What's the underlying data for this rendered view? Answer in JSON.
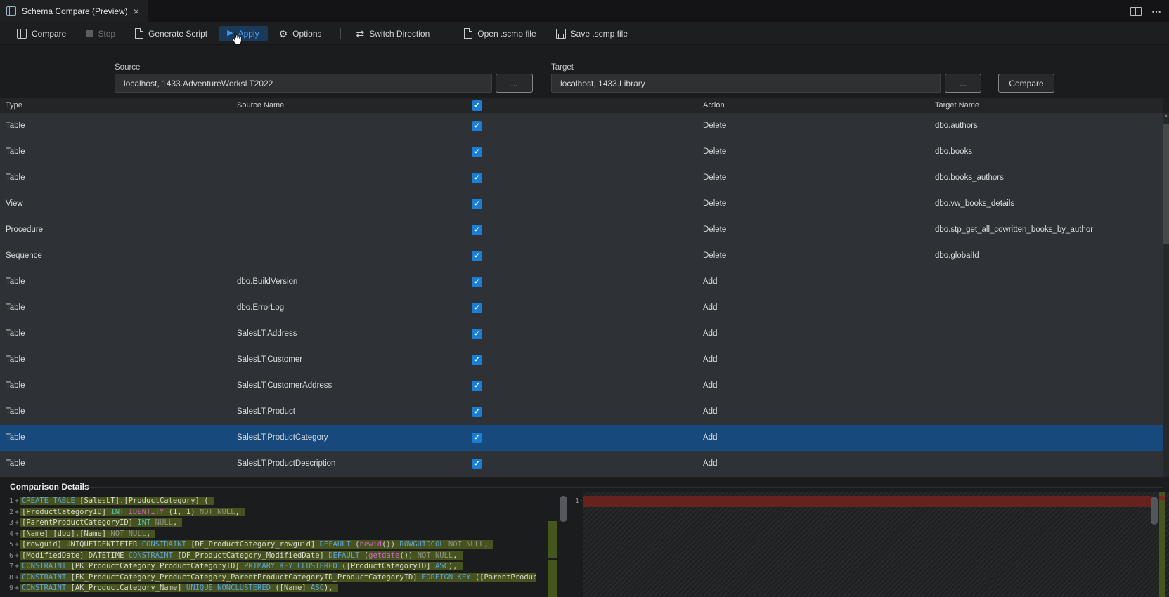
{
  "colors": {
    "accent_blue": "#3f9bf0",
    "checkbox_blue": "#1a7fd4",
    "selected_row": "#17497c",
    "diff_added_bg": "#47531f",
    "diff_removed_bar": "#66231d",
    "overview_green": "#45561f"
  },
  "icons": {
    "check": "✓",
    "more": "⋯",
    "scroll_up": "▲"
  },
  "tab_bar": {
    "title": "Schema Compare (Preview)",
    "close": "×"
  },
  "toolbar": {
    "items": [
      {
        "name": "compare",
        "label": "Compare",
        "icon": "compare",
        "glyph": ""
      },
      {
        "name": "stop",
        "label": "Stop",
        "icon": "stop",
        "glyph": "",
        "disabled": true
      },
      {
        "name": "generate-script",
        "label": "Generate Script",
        "icon": "doc",
        "glyph": ""
      },
      {
        "name": "apply",
        "label": "Apply",
        "icon": "play",
        "glyph": "▶",
        "active": true
      },
      {
        "name": "options",
        "label": "Options",
        "icon": "gear",
        "glyph": "⚙"
      },
      {
        "separator": true
      },
      {
        "name": "switch-direction",
        "label": "Switch Direction",
        "icon": "swap",
        "glyph": "⇄"
      },
      {
        "separator": true
      },
      {
        "name": "open-scmp-file",
        "label": "Open .scmp file",
        "icon": "doc",
        "glyph": ""
      },
      {
        "name": "save-scmp-file",
        "label": "Save .scmp file",
        "icon": "save",
        "glyph": ""
      }
    ]
  },
  "form": {
    "source_label": "Source",
    "source_value": "localhost, 1433.AdventureWorksLT2022",
    "target_label": "Target",
    "target_value": "localhost, 1433.Library",
    "browse_label": "...",
    "compare_label": "Compare"
  },
  "table": {
    "headers": [
      "Type",
      "Source Name",
      "Action",
      "Target Name"
    ],
    "rows": [
      {
        "type": "Table",
        "source": "",
        "action": "Delete",
        "target": "dbo.authors",
        "checked": true
      },
      {
        "type": "Table",
        "source": "",
        "action": "Delete",
        "target": "dbo.books",
        "checked": true
      },
      {
        "type": "Table",
        "source": "",
        "action": "Delete",
        "target": "dbo.books_authors",
        "checked": true
      },
      {
        "type": "View",
        "source": "",
        "action": "Delete",
        "target": "dbo.vw_books_details",
        "checked": true
      },
      {
        "type": "Procedure",
        "source": "",
        "action": "Delete",
        "target": "dbo.stp_get_all_cowritten_books_by_author",
        "checked": true
      },
      {
        "type": "Sequence",
        "source": "",
        "action": "Delete",
        "target": "dbo.globalId",
        "checked": true
      },
      {
        "type": "Table",
        "source": "dbo.BuildVersion",
        "action": "Add",
        "target": "",
        "checked": true
      },
      {
        "type": "Table",
        "source": "dbo.ErrorLog",
        "action": "Add",
        "target": "",
        "checked": true
      },
      {
        "type": "Table",
        "source": "SalesLT.Address",
        "action": "Add",
        "target": "",
        "checked": true
      },
      {
        "type": "Table",
        "source": "SalesLT.Customer",
        "action": "Add",
        "target": "",
        "checked": true
      },
      {
        "type": "Table",
        "source": "SalesLT.CustomerAddress",
        "action": "Add",
        "target": "",
        "checked": true
      },
      {
        "type": "Table",
        "source": "SalesLT.Product",
        "action": "Add",
        "target": "",
        "checked": true
      },
      {
        "type": "Table",
        "source": "SalesLT.ProductCategory",
        "action": "Add",
        "target": "",
        "checked": true,
        "selected": true
      },
      {
        "type": "Table",
        "source": "SalesLT.ProductDescription",
        "action": "Add",
        "target": "",
        "checked": true
      }
    ]
  },
  "details": {
    "title": "Comparison Details",
    "right_line_num": "1",
    "right_marker": "-",
    "left_lines": [
      {
        "num": "1",
        "marker": "+",
        "segments": [
          {
            "t": "CREATE TABLE",
            "c": "kw"
          },
          {
            "t": " [SalesLT].[ProductCategory] (",
            "c": "id"
          }
        ]
      },
      {
        "num": "2",
        "marker": "+",
        "segments": [
          {
            "t": "[ProductCategoryID] ",
            "c": "id"
          },
          {
            "t": "INT",
            "c": "type"
          },
          {
            "t": " ",
            "c": "id"
          },
          {
            "t": "IDENTITY",
            "c": "fn"
          },
          {
            "t": " (1, 1) ",
            "c": "id"
          },
          {
            "t": "NOT NULL",
            "c": "dim"
          },
          {
            "t": ",",
            "c": "id"
          }
        ]
      },
      {
        "num": "3",
        "marker": "+",
        "segments": [
          {
            "t": "[ParentProductCategoryID] ",
            "c": "id"
          },
          {
            "t": "INT",
            "c": "type"
          },
          {
            "t": " ",
            "c": "id"
          },
          {
            "t": "NULL",
            "c": "dim"
          },
          {
            "t": ",",
            "c": "id"
          }
        ]
      },
      {
        "num": "4",
        "marker": "+",
        "segments": [
          {
            "t": "[Name] [dbo].[Name] ",
            "c": "id"
          },
          {
            "t": "NOT NULL",
            "c": "dim"
          },
          {
            "t": ",",
            "c": "id"
          }
        ]
      },
      {
        "num": "5",
        "marker": "+",
        "segments": [
          {
            "t": "[rowguid] UNIQUEIDENTIFIER ",
            "c": "id"
          },
          {
            "t": "CONSTRAINT",
            "c": "kw"
          },
          {
            "t": " [DF_ProductCategory_rowguid] ",
            "c": "id"
          },
          {
            "t": "DEFAULT",
            "c": "kw"
          },
          {
            "t": " (",
            "c": "id"
          },
          {
            "t": "newid",
            "c": "fn"
          },
          {
            "t": "()) ",
            "c": "id"
          },
          {
            "t": "ROWGUIDCOL",
            "c": "kw"
          },
          {
            "t": " ",
            "c": "id"
          },
          {
            "t": "NOT NULL",
            "c": "dim"
          },
          {
            "t": ",",
            "c": "id"
          }
        ]
      },
      {
        "num": "6",
        "marker": "+",
        "segments": [
          {
            "t": "[ModifiedDate] DATETIME ",
            "c": "id"
          },
          {
            "t": "CONSTRAINT",
            "c": "kw"
          },
          {
            "t": " [DF_ProductCategory_ModifiedDate] ",
            "c": "id"
          },
          {
            "t": "DEFAULT",
            "c": "kw"
          },
          {
            "t": " (",
            "c": "id"
          },
          {
            "t": "getdate",
            "c": "fn"
          },
          {
            "t": "()) ",
            "c": "id"
          },
          {
            "t": "NOT NULL",
            "c": "dim"
          },
          {
            "t": ",",
            "c": "id"
          }
        ]
      },
      {
        "num": "7",
        "marker": "+",
        "segments": [
          {
            "t": "CONSTRAINT",
            "c": "kw"
          },
          {
            "t": " [PK_ProductCategory_ProductCategoryID] ",
            "c": "id"
          },
          {
            "t": "PRIMARY KEY CLUSTERED",
            "c": "kw"
          },
          {
            "t": " ([ProductCategoryID] ",
            "c": "id"
          },
          {
            "t": "ASC",
            "c": "kw"
          },
          {
            "t": "),",
            "c": "id"
          }
        ]
      },
      {
        "num": "8",
        "marker": "+",
        "segments": [
          {
            "t": "CONSTRAINT",
            "c": "kw"
          },
          {
            "t": " [FK_ProductCategory_ProductCategory_ParentProductCategoryID_ProductCategoryID] ",
            "c": "id"
          },
          {
            "t": "FOREIGN KEY",
            "c": "kw"
          },
          {
            "t": " ([ParentProductCategoryID]",
            "c": "id"
          }
        ]
      },
      {
        "num": "9",
        "marker": "+",
        "segments": [
          {
            "t": "CONSTRAINT",
            "c": "kw"
          },
          {
            "t": " [AK_ProductCategory_Name] ",
            "c": "id"
          },
          {
            "t": "UNIQUE NONCLUSTERED",
            "c": "kw"
          },
          {
            "t": " ([Name] ",
            "c": "id"
          },
          {
            "t": "ASC",
            "c": "kw"
          },
          {
            "t": "),",
            "c": "id"
          }
        ]
      }
    ]
  }
}
